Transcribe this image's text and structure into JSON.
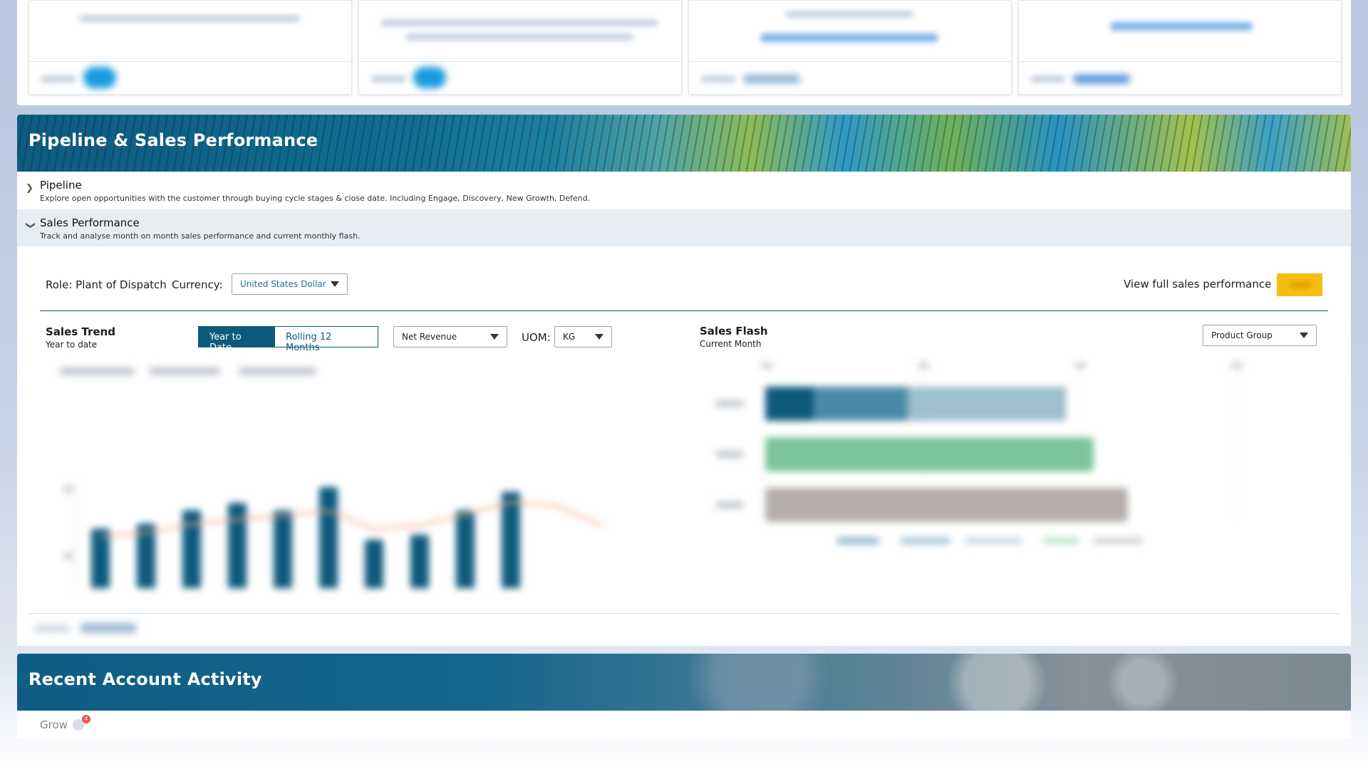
{
  "pipeline_section": {
    "title": "Pipeline & Sales Performance",
    "pipeline": {
      "title": "Pipeline",
      "description": "Explore open opportunities with the customer through buying cycle stages & close date. Including Engage, Discovery, New Growth, Defend."
    },
    "sales_performance": {
      "title": "Sales Performance",
      "description": "Track and analyse month on month sales performance and current monthly flash."
    }
  },
  "filters": {
    "role_label": "Role: Plant of Dispatch",
    "currency_label": "Currency:",
    "currency_value": "United States Dollar",
    "view_full_label": "View full sales performance"
  },
  "sales_trend": {
    "title": "Sales Trend",
    "subtitle": "Year to date",
    "toggle_ytd": "Year to Date",
    "toggle_r12": "Rolling 12 Months",
    "metric_value": "Net Revenue",
    "uom_label": "UOM:",
    "uom_value": "KG"
  },
  "sales_flash": {
    "title": "Sales Flash",
    "subtitle": "Current Month",
    "group_value": "Product Group"
  },
  "activity_section": {
    "title": "Recent Account Activity",
    "grow_label": "Grow",
    "badge_count": "4"
  },
  "colors": {
    "primary": "#0e5a7d",
    "accent_yellow": "#f6be0f",
    "line_orange": "#f4a98a",
    "bar_green": "#7cc59a",
    "bar_grey": "#b5aeab"
  },
  "chart_data": [
    {
      "type": "bar",
      "title": "",
      "series": [
        {
          "values": [
            66,
            70,
            81,
            87,
            81,
            100,
            57,
            61,
            81,
            96,
            0,
            0
          ]
        },
        {
          "values": [
            62,
            65,
            72,
            76,
            79,
            83,
            68,
            71,
            80,
            90,
            87,
            71
          ]
        }
      ],
      "ylim": [
        0,
        100
      ],
      "grid": false,
      "legend": "bottom"
    },
    {
      "type": "bar",
      "orientation": "horizontal",
      "title": "",
      "series": [
        {
          "values": [
            88,
            96,
            106
          ]
        }
      ],
      "xlim": [
        0,
        100
      ],
      "grid": true,
      "legend": "bottom"
    }
  ]
}
